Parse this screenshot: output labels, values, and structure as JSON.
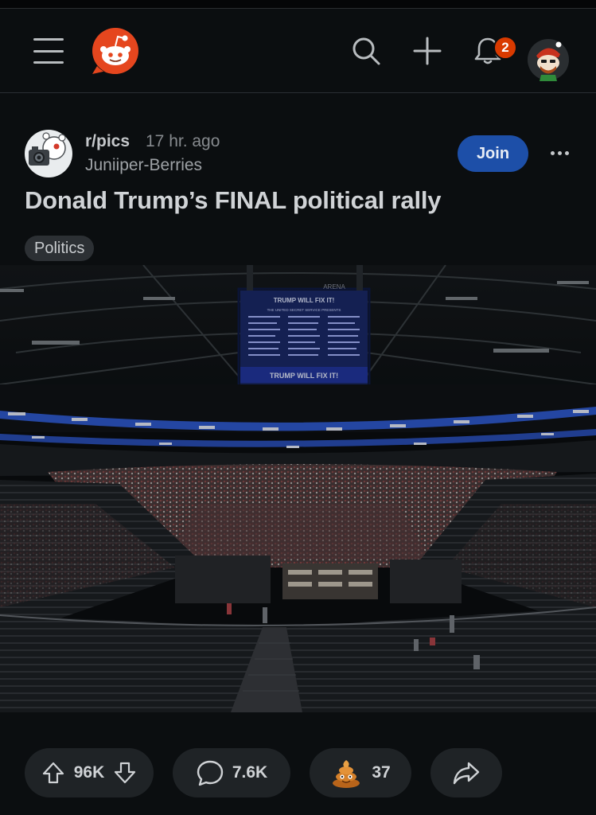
{
  "topbar": {
    "notification_count": "2",
    "icons": [
      "menu-icon",
      "reddit-logo",
      "search-icon",
      "plus-icon",
      "bell-icon",
      "user-avatar"
    ]
  },
  "post": {
    "subreddit": "r/pics",
    "time_ago": "17 hr. ago",
    "author": "Juniiper-Berries",
    "join_label": "Join",
    "title": "Donald Trump’s FINAL political rally",
    "flair": "Politics",
    "image": {
      "scoreboard_top_text": "TRUMP WILL FIX IT!",
      "scoreboard_sub_text": "THE UNITED SECRET SERVICE PRESENTS",
      "scoreboard_bottom_text": "TRUMP WILL FIX IT!",
      "arena_sign": "ARENA"
    }
  },
  "actions": {
    "vote_count": "96K",
    "comment_count": "7.6K",
    "award_count": "37",
    "icons": [
      "upvote-icon",
      "downvote-icon",
      "comment-icon",
      "award-icon",
      "share-icon"
    ]
  },
  "colors": {
    "background": "#0b0e10",
    "brand_orange": "#ff4500",
    "join_blue": "#1d4fa8",
    "badge": "#d93a00",
    "pill": "#1f2326"
  }
}
